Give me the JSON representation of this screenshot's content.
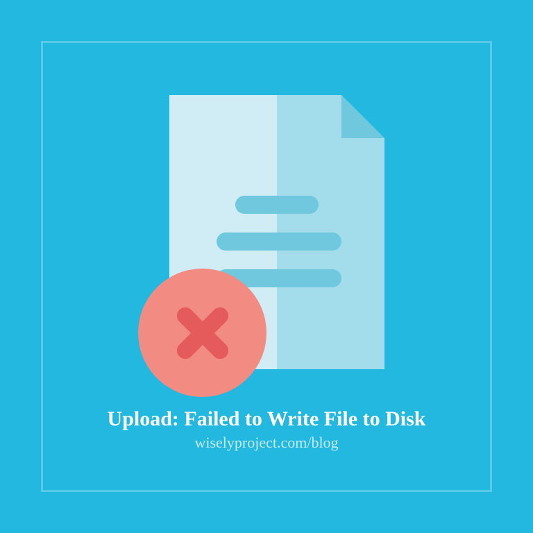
{
  "title": "Upload: Failed to Write File to Disk",
  "subtitle": "wiselyproject.com/blog",
  "colors": {
    "background": "#22b8e0",
    "docLight": "#d0edf6",
    "docMid": "#a3ddec",
    "docLines": "#6fc8de",
    "errorBadge": "#f28b82",
    "errorX": "#e55a5a",
    "titleText": "#ffffff",
    "subtitleText": "#c5ebf4"
  }
}
